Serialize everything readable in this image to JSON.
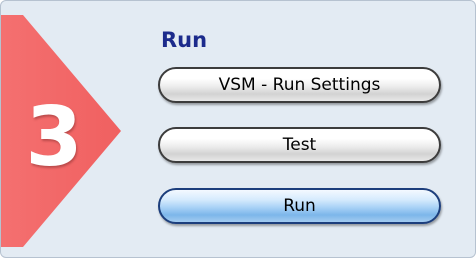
{
  "step": {
    "number": "3",
    "badge_color": "#f26b6b"
  },
  "section": {
    "title": "Run"
  },
  "buttons": [
    {
      "label": "VSM - Run Settings",
      "style": "grey"
    },
    {
      "label": "Test",
      "style": "grey"
    },
    {
      "label": "Run",
      "style": "blue"
    }
  ],
  "colors": {
    "panel_background": "#e3ebf3",
    "title_text": "#1c2b8c",
    "run_button_blue": "#a8d1f6"
  }
}
